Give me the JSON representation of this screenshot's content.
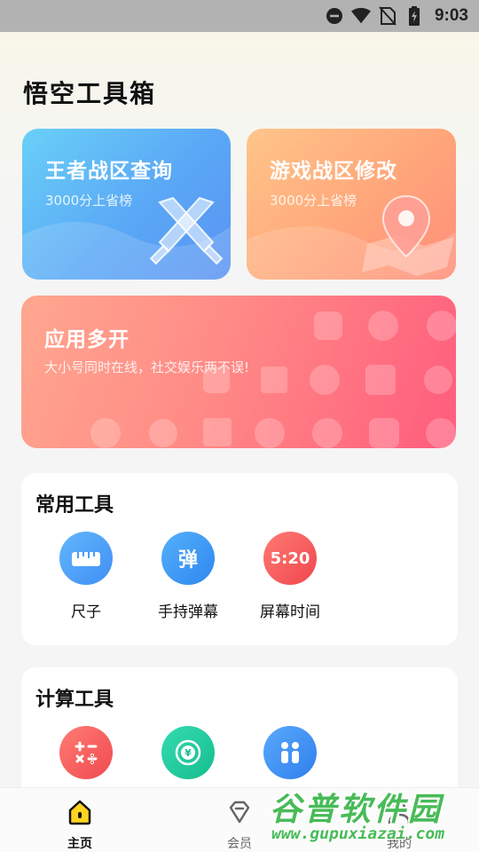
{
  "status_bar": {
    "time": "9:03",
    "icons": [
      "do-not-disturb-icon",
      "wifi-icon",
      "no-sim-icon",
      "battery-charging-icon"
    ]
  },
  "app": {
    "title": "悟空工具箱"
  },
  "cards": {
    "king": {
      "title": "王者战区查询",
      "subtitle": "3000分上省榜",
      "icon": "crossed-swords-icon"
    },
    "game": {
      "title": "游戏战区修改",
      "subtitle": "3000分上省榜",
      "icon": "map-pin-icon"
    },
    "multi": {
      "title": "应用多开",
      "subtitle": "大小号同时在线，社交娱乐两不误!"
    }
  },
  "common_tools": {
    "title": "常用工具",
    "items": [
      {
        "label": "尺子",
        "icon": "ruler-icon",
        "color": "#4a9df6"
      },
      {
        "label": "手持弹幕",
        "icon": "danmu-icon",
        "glyph": "弹",
        "color": "#3b95f3"
      },
      {
        "label": "屏幕时间",
        "icon": "clock-text-icon",
        "glyph": "5:20",
        "color": "#f65a5e"
      }
    ]
  },
  "calc_tools": {
    "title": "计算工具",
    "items": [
      {
        "icon": "calculator-icon",
        "color": "#f66061"
      },
      {
        "icon": "currency-exchange-icon",
        "color": "#26c9a0"
      },
      {
        "icon": "people-icon",
        "color": "#3d8ff2"
      }
    ]
  },
  "tabbar": {
    "items": [
      {
        "label": "主页",
        "icon": "home-icon",
        "active": true
      },
      {
        "label": "会员",
        "icon": "diamond-icon",
        "active": false
      },
      {
        "label": "我的",
        "icon": "profile-icon",
        "active": false
      }
    ]
  },
  "watermark": {
    "text": "谷普软件园",
    "url": "www.gupuxiazai.com"
  },
  "colors": {
    "accent_yellow": "#ffd320",
    "text": "#111111"
  }
}
